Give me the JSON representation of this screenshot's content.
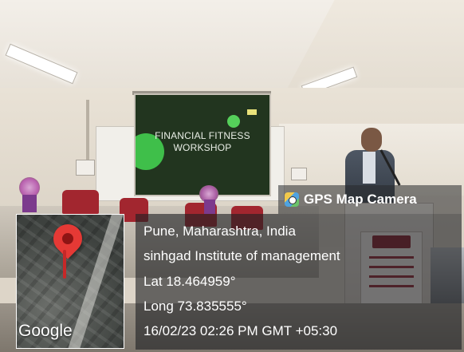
{
  "projection": {
    "slide_title_line1": "FINANCIAL FITNESS",
    "slide_title_line2": "WORKSHOP"
  },
  "gps_overlay": {
    "app_label": "GPS Map Camera",
    "icon": "camera-app-icon",
    "map_provider": "Google",
    "pin_icon": "map-pin-icon",
    "location_line": "Pune, Maharashtra, India",
    "place_line": "sinhgad Institute of management",
    "latitude_line": "Lat 18.464959°",
    "longitude_line": "Long 73.835555°",
    "timestamp_line": "16/02/23 02:26 PM GMT +05:30"
  },
  "colors": {
    "pin": "#e53935",
    "overlay_bg": "#1e2124",
    "slide_bg": "#22351f",
    "accent_green": "#3fbf4a"
  }
}
